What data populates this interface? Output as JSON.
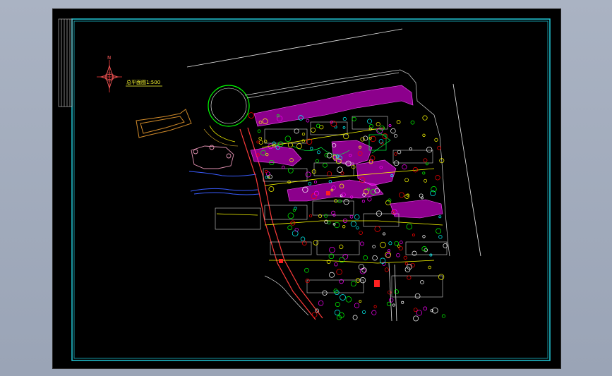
{
  "viewer": {
    "background": "#000000",
    "frame_color": "#22c8d8",
    "inner_frame_color": "#19b7c6"
  },
  "plan": {
    "title_label": "总平面图1:500",
    "road_label_1": "",
    "road_label_2": "",
    "road_label_3": ""
  },
  "icons": [
    "north-arrow-icon"
  ],
  "colors": {
    "magenta": "#ff00ff",
    "green": "#00ff00",
    "yellow": "#ffff00",
    "red": "#ff0000",
    "cyan": "#00ffff",
    "white": "#ffffff",
    "orange": "#d08a2a",
    "blue": "#3a5cff"
  }
}
